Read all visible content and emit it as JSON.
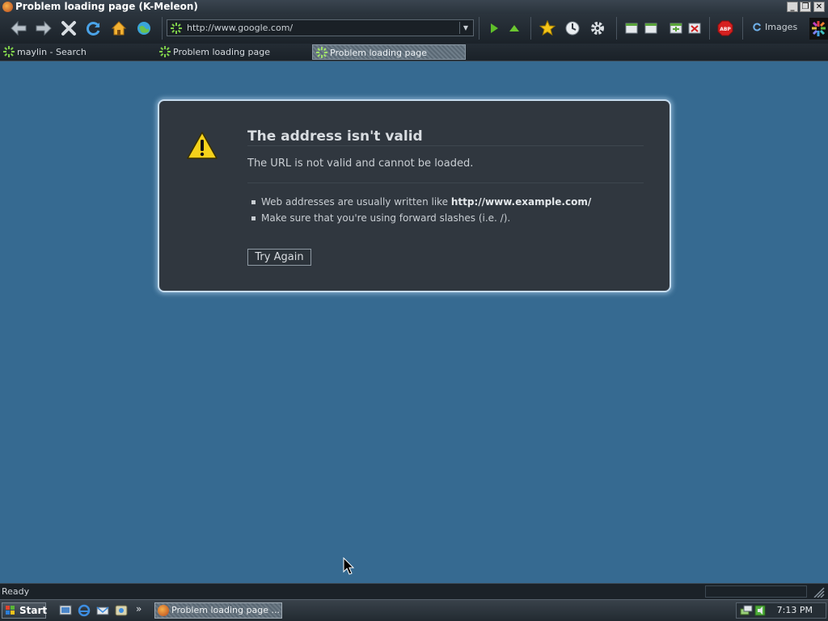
{
  "window": {
    "title": "Problem loading page (K-Meleon)",
    "controls": [
      "_",
      "❐",
      "✕"
    ]
  },
  "toolbar": {
    "url": "http://www.google.com/",
    "images_label": "Images",
    "buttons": [
      "back",
      "forward",
      "stop",
      "reload",
      "home",
      "go",
      "play",
      "up",
      "bookmarks",
      "history",
      "settings",
      "window-1",
      "window-2",
      "window-3",
      "close-window",
      "adblock"
    ]
  },
  "tabs": [
    {
      "label": "maylin - Search",
      "active": false
    },
    {
      "label": "Problem loading page",
      "active": false
    },
    {
      "label": "Problem loading page",
      "active": true
    }
  ],
  "error": {
    "title": "The address isn't valid",
    "subtitle": "The URL is not valid and cannot be loaded.",
    "bullets": [
      {
        "text": "Web addresses are usually written like ",
        "bold": "http://www.example.com/"
      },
      {
        "text": "Make sure that you're using forward slashes (i.e. /).",
        "bold": ""
      }
    ],
    "button_label": "Try Again"
  },
  "statusbar": {
    "text": "Ready"
  },
  "taskbar": {
    "start_label": "Start",
    "task_label": "Problem loading page ...",
    "clock": "7:13 PM",
    "overflow": "»"
  },
  "colors": {
    "content_bg": "#366a91",
    "dialog_bg": "#30373f",
    "dialog_glow": "#c6dcef",
    "warning_yellow": "#f6d21b"
  }
}
